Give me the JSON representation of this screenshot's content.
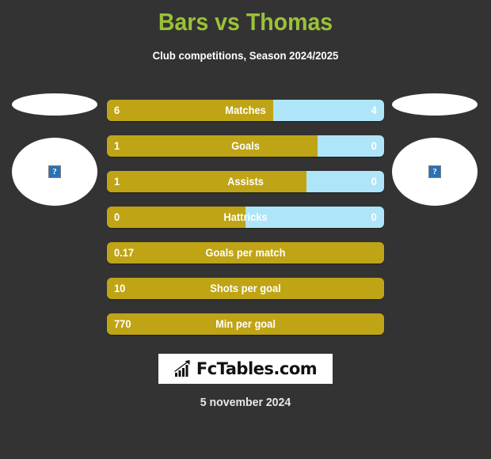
{
  "header": {
    "title": "Bars vs Thomas",
    "subtitle": "Club competitions, Season 2024/2025",
    "title_color": "#9ac238"
  },
  "theme": {
    "background": "#333333",
    "home_color": "#bfa415",
    "away_color": "#aee5f9",
    "text_color": "#ffffff"
  },
  "teams": {
    "home": "Bars",
    "away": "Thomas",
    "home_logo_alt": "?",
    "away_logo_alt": "?"
  },
  "chart_data": {
    "type": "bar",
    "title": "Bars vs Thomas",
    "subtitle": "Club competitions, Season 2024/2025",
    "orientation": "horizontal-diverging",
    "series": [
      {
        "name": "Bars",
        "color": "#bfa415"
      },
      {
        "name": "Thomas",
        "color": "#aee5f9"
      }
    ],
    "categories": [
      "Matches",
      "Goals",
      "Assists",
      "Hattricks",
      "Goals per match",
      "Shots per goal",
      "Min per goal"
    ],
    "rows": [
      {
        "label": "Matches",
        "left": "6",
        "right": "4",
        "fill_pct": 60,
        "two_sided": true
      },
      {
        "label": "Goals",
        "left": "1",
        "right": "0",
        "fill_pct": 76,
        "two_sided": true
      },
      {
        "label": "Assists",
        "left": "1",
        "right": "0",
        "fill_pct": 72,
        "two_sided": true
      },
      {
        "label": "Hattricks",
        "left": "0",
        "right": "0",
        "fill_pct": 50,
        "two_sided": true
      },
      {
        "label": "Goals per match",
        "left": "0.17",
        "right": "",
        "fill_pct": 100,
        "two_sided": false
      },
      {
        "label": "Shots per goal",
        "left": "10",
        "right": "",
        "fill_pct": 100,
        "two_sided": false
      },
      {
        "label": "Min per goal",
        "left": "770",
        "right": "",
        "fill_pct": 100,
        "two_sided": false
      }
    ]
  },
  "footer": {
    "logo_text": "FcTables.com",
    "logo_icon": "bar-chart-arrow-icon",
    "date": "5 november 2024"
  }
}
